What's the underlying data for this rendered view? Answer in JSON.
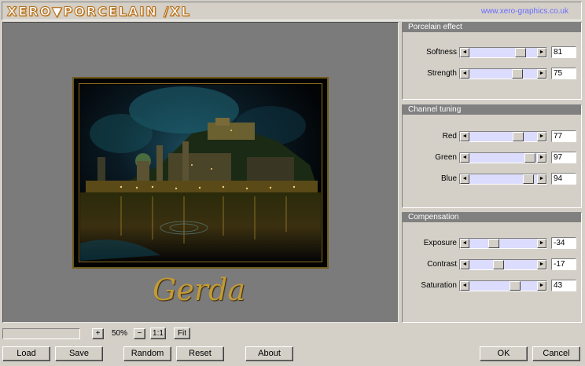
{
  "header": {
    "logo_text": "XERO▼PORCELAIN /XL",
    "site_url": "www.xero-graphics.co.uk"
  },
  "preview": {
    "image_name": "night-city-photo",
    "signature": "Gerda"
  },
  "panels": {
    "porcelain": {
      "title": "Porcelain effect",
      "sliders": [
        {
          "label": "Softness",
          "value": "81",
          "level": 0.81
        },
        {
          "label": "Strength",
          "value": "75",
          "level": 0.75
        }
      ]
    },
    "channel": {
      "title": "Channel tuning",
      "sliders": [
        {
          "label": "Red",
          "value": "77",
          "level": 0.77
        },
        {
          "label": "Green",
          "value": "97",
          "level": 0.97
        },
        {
          "label": "Blue",
          "value": "94",
          "level": 0.94
        }
      ]
    },
    "compensation": {
      "title": "Compensation",
      "sliders": [
        {
          "label": "Exposure",
          "value": "-34",
          "level": 0.33
        },
        {
          "label": "Contrast",
          "value": "-17",
          "level": 0.415
        },
        {
          "label": "Saturation",
          "value": "43",
          "level": 0.715
        }
      ]
    }
  },
  "zoom": {
    "plus_label": "+",
    "value": "50%",
    "minus_label": "−",
    "actual_label": "1:1",
    "fit_label": "Fit"
  },
  "buttons": {
    "load": "Load",
    "save": "Save",
    "random": "Random",
    "reset": "Reset",
    "about": "About",
    "ok": "OK",
    "cancel": "Cancel"
  },
  "colors": {
    "accent_orange": "#e8a040",
    "link_blue": "#6a6aff",
    "slider_track": "#dcdcff",
    "signature_gold": "#c29a36"
  }
}
